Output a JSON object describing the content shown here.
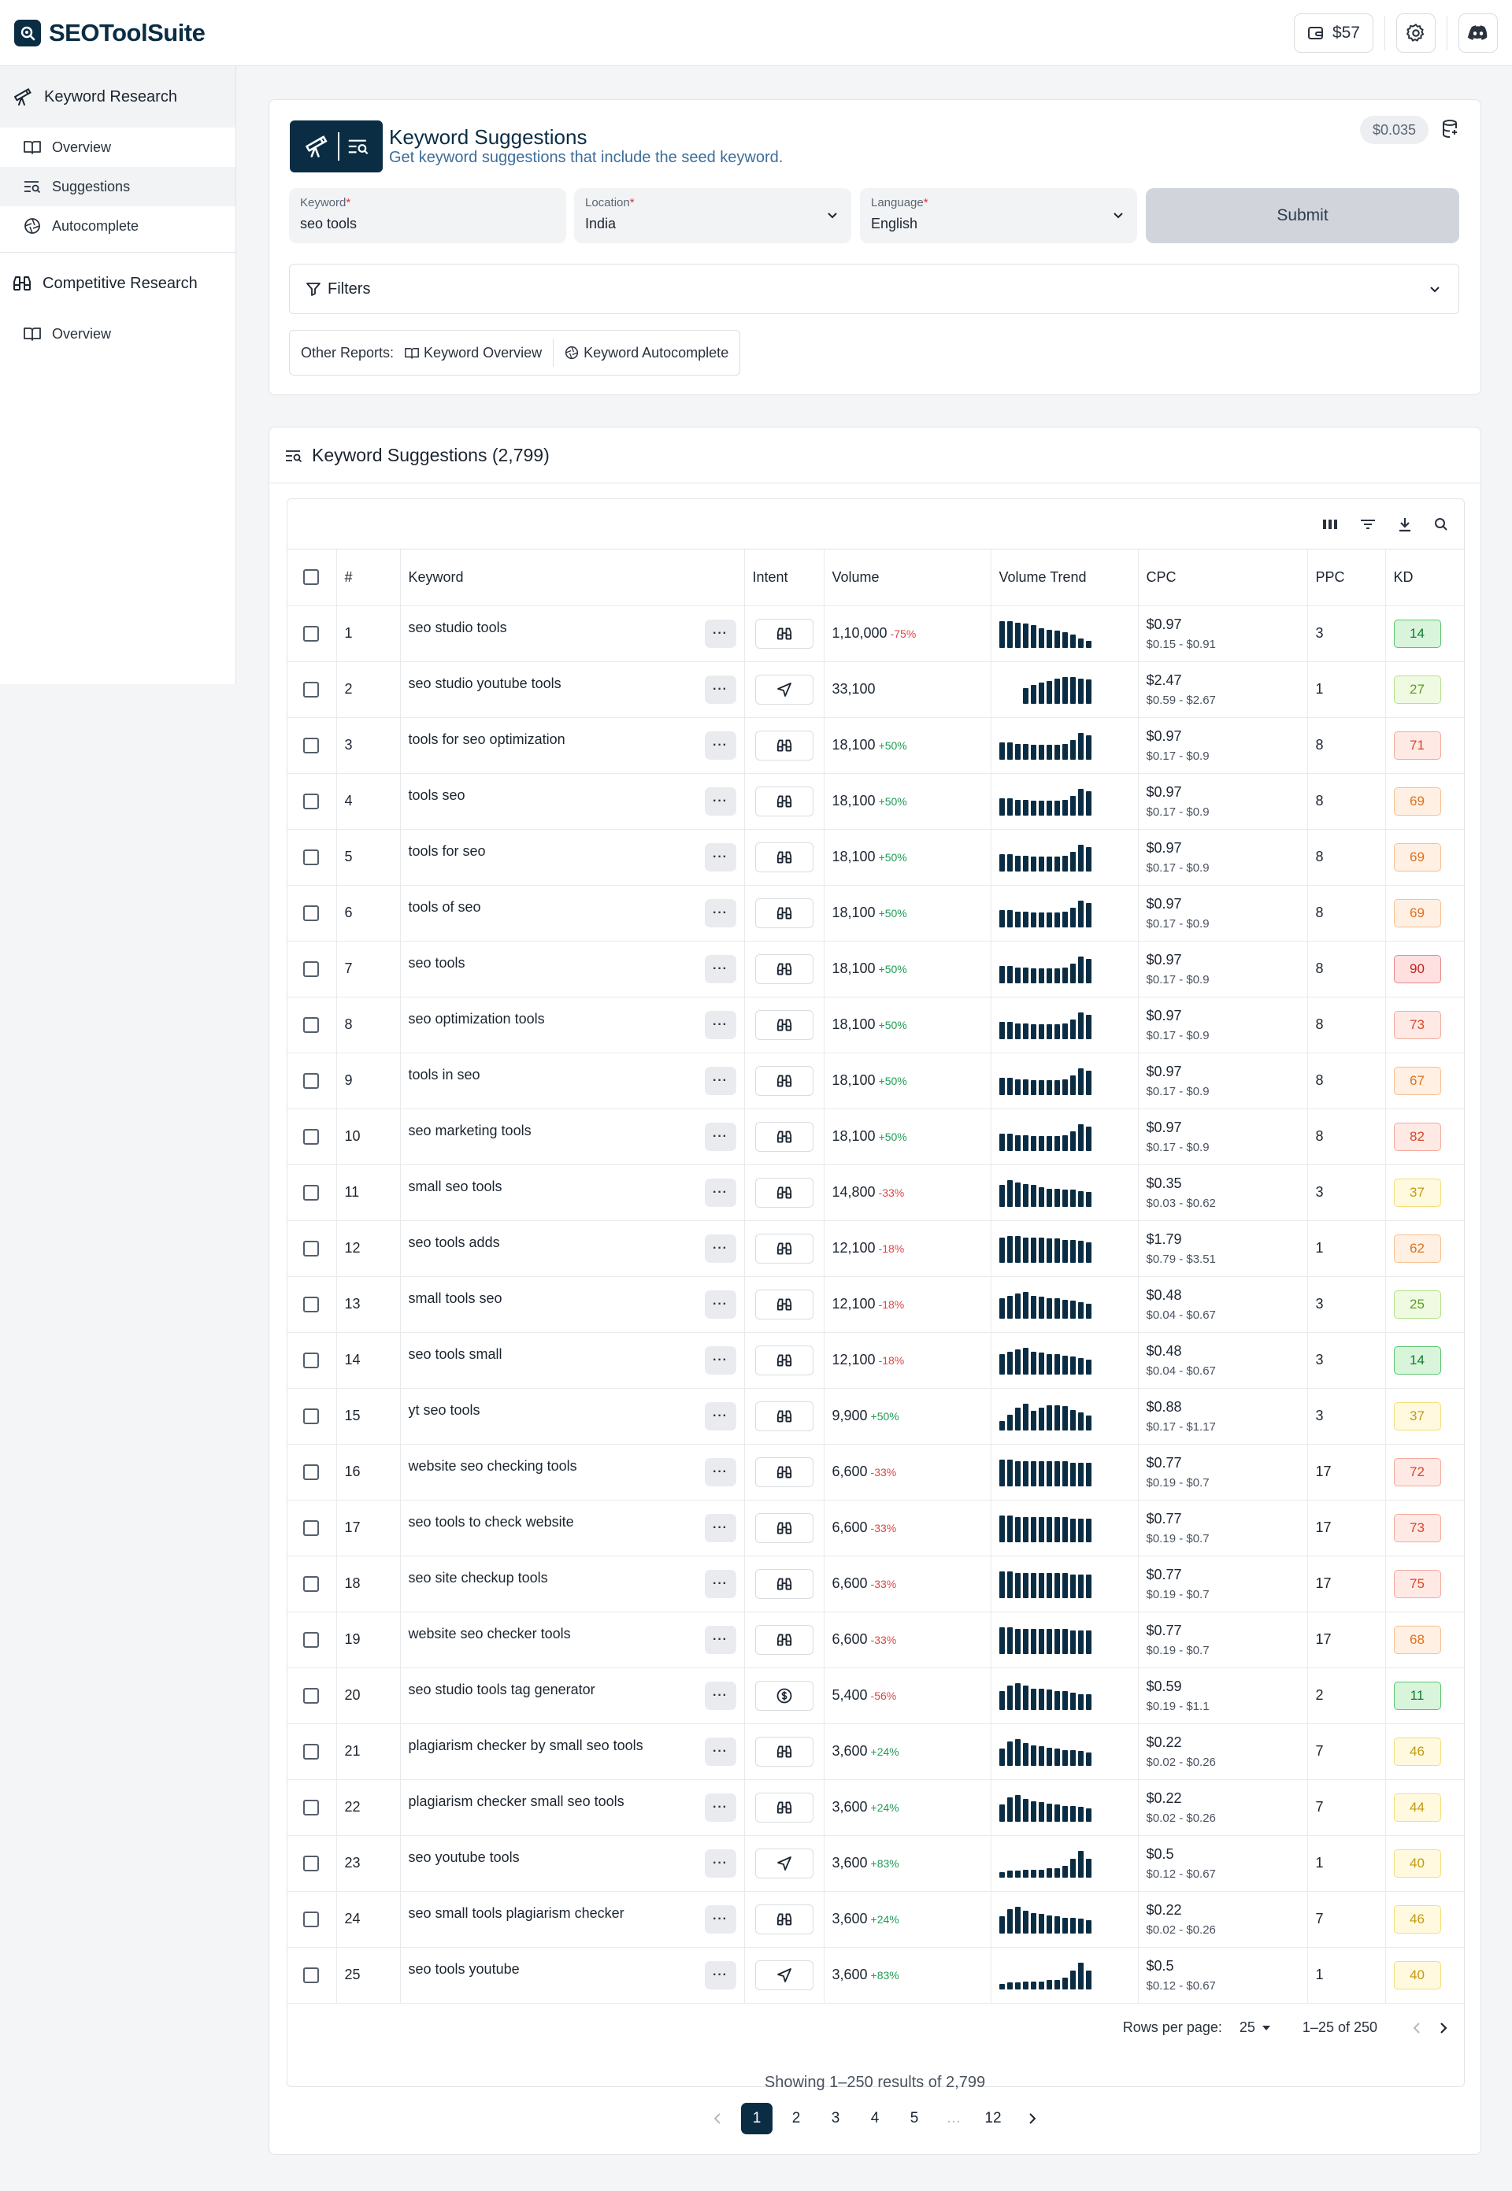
{
  "app": {
    "name": "SEOToolSuite",
    "credits": "$57"
  },
  "sidebar": {
    "groups": [
      {
        "label": "Keyword Research",
        "items": [
          {
            "label": "Overview"
          },
          {
            "label": "Suggestions"
          },
          {
            "label": "Autocomplete"
          }
        ]
      },
      {
        "label": "Competitive Research",
        "items": [
          {
            "label": "Overview"
          }
        ]
      }
    ]
  },
  "form": {
    "title": "Keyword Suggestions",
    "subtitle": "Get keyword suggestions that include the seed keyword.",
    "price": "$0.035",
    "keyword": {
      "label": "Keyword",
      "value": "seo tools"
    },
    "location": {
      "label": "Location",
      "value": "India"
    },
    "language": {
      "label": "Language",
      "value": "English"
    },
    "submit_label": "Submit",
    "filters_label": "Filters",
    "other_reports_label": "Other Reports:",
    "other_reports": [
      "Keyword Overview",
      "Keyword Autocomplete"
    ]
  },
  "results": {
    "title": "Keyword Suggestions (2,799)",
    "columns": {
      "num": "#",
      "keyword": "Keyword",
      "intent": "Intent",
      "volume": "Volume",
      "trend": "Volume Trend",
      "cpc": "CPC",
      "ppc": "PPC",
      "kd": "KD"
    },
    "rows": [
      {
        "n": "1",
        "kw": "seo studio tools",
        "intent": "binoculars",
        "vol": "1,10,000",
        "chg": "-75%",
        "dir": "down",
        "cpc": "$0.97",
        "range": "$0.15 - $0.91",
        "ppc": "3",
        "kd": "14",
        "trend": [
          22,
          22,
          21,
          20,
          19,
          16,
          15,
          14,
          13,
          11,
          8,
          6
        ]
      },
      {
        "n": "2",
        "kw": "seo studio youtube tools",
        "intent": "navigation",
        "vol": "33,100",
        "chg": "",
        "dir": "",
        "cpc": "$2.47",
        "range": "$0.59 - $2.67",
        "ppc": "1",
        "kd": "27",
        "trend": [
          0,
          0,
          0,
          12,
          14,
          16,
          17,
          19,
          20,
          20,
          19,
          18
        ]
      },
      {
        "n": "3",
        "kw": "tools for seo optimization",
        "intent": "binoculars",
        "vol": "18,100",
        "chg": "+50%",
        "dir": "up",
        "cpc": "$0.97",
        "range": "$0.17 - $0.9",
        "ppc": "8",
        "kd": "71",
        "trend": [
          14,
          14,
          13,
          13,
          12,
          12,
          12,
          12,
          13,
          16,
          22,
          20
        ]
      },
      {
        "n": "4",
        "kw": "tools seo",
        "intent": "binoculars",
        "vol": "18,100",
        "chg": "+50%",
        "dir": "up",
        "cpc": "$0.97",
        "range": "$0.17 - $0.9",
        "ppc": "8",
        "kd": "69",
        "trend": [
          14,
          14,
          13,
          13,
          12,
          12,
          12,
          12,
          13,
          16,
          22,
          20
        ]
      },
      {
        "n": "5",
        "kw": "tools for seo",
        "intent": "binoculars",
        "vol": "18,100",
        "chg": "+50%",
        "dir": "up",
        "cpc": "$0.97",
        "range": "$0.17 - $0.9",
        "ppc": "8",
        "kd": "69",
        "trend": [
          14,
          14,
          13,
          13,
          12,
          12,
          12,
          12,
          13,
          16,
          22,
          20
        ]
      },
      {
        "n": "6",
        "kw": "tools of seo",
        "intent": "binoculars",
        "vol": "18,100",
        "chg": "+50%",
        "dir": "up",
        "cpc": "$0.97",
        "range": "$0.17 - $0.9",
        "ppc": "8",
        "kd": "69",
        "trend": [
          14,
          14,
          13,
          13,
          12,
          12,
          12,
          12,
          13,
          16,
          22,
          20
        ]
      },
      {
        "n": "7",
        "kw": "seo tools",
        "intent": "binoculars",
        "vol": "18,100",
        "chg": "+50%",
        "dir": "up",
        "cpc": "$0.97",
        "range": "$0.17 - $0.9",
        "ppc": "8",
        "kd": "90",
        "trend": [
          14,
          14,
          13,
          13,
          12,
          12,
          12,
          12,
          13,
          16,
          22,
          20
        ]
      },
      {
        "n": "8",
        "kw": "seo optimization tools",
        "intent": "binoculars",
        "vol": "18,100",
        "chg": "+50%",
        "dir": "up",
        "cpc": "$0.97",
        "range": "$0.17 - $0.9",
        "ppc": "8",
        "kd": "73",
        "trend": [
          14,
          14,
          13,
          13,
          12,
          12,
          12,
          12,
          13,
          16,
          22,
          20
        ]
      },
      {
        "n": "9",
        "kw": "tools in seo",
        "intent": "binoculars",
        "vol": "18,100",
        "chg": "+50%",
        "dir": "up",
        "cpc": "$0.97",
        "range": "$0.17 - $0.9",
        "ppc": "8",
        "kd": "67",
        "trend": [
          14,
          14,
          13,
          13,
          12,
          12,
          12,
          12,
          13,
          16,
          22,
          20
        ]
      },
      {
        "n": "10",
        "kw": "seo marketing tools",
        "intent": "binoculars",
        "vol": "18,100",
        "chg": "+50%",
        "dir": "up",
        "cpc": "$0.97",
        "range": "$0.17 - $0.9",
        "ppc": "8",
        "kd": "82",
        "trend": [
          14,
          14,
          13,
          13,
          12,
          12,
          12,
          12,
          13,
          16,
          22,
          20
        ]
      },
      {
        "n": "11",
        "kw": "small seo tools",
        "intent": "binoculars",
        "vol": "14,800",
        "chg": "-33%",
        "dir": "down",
        "cpc": "$0.35",
        "range": "$0.03 - $0.62",
        "ppc": "3",
        "kd": "37",
        "trend": [
          18,
          22,
          20,
          19,
          18,
          16,
          15,
          15,
          14,
          14,
          13,
          12
        ]
      },
      {
        "n": "12",
        "kw": "seo tools adds",
        "intent": "binoculars",
        "vol": "12,100",
        "chg": "-18%",
        "dir": "down",
        "cpc": "$1.79",
        "range": "$0.79 - $3.51",
        "ppc": "1",
        "kd": "62",
        "trend": [
          20,
          21,
          21,
          20,
          20,
          20,
          19,
          19,
          18,
          18,
          17,
          16
        ]
      },
      {
        "n": "13",
        "kw": "small tools seo",
        "intent": "binoculars",
        "vol": "12,100",
        "chg": "-18%",
        "dir": "down",
        "cpc": "$0.48",
        "range": "$0.04 - $0.67",
        "ppc": "3",
        "kd": "25",
        "trend": [
          16,
          18,
          20,
          21,
          18,
          17,
          16,
          16,
          15,
          14,
          13,
          12
        ]
      },
      {
        "n": "14",
        "kw": "seo tools small",
        "intent": "binoculars",
        "vol": "12,100",
        "chg": "-18%",
        "dir": "down",
        "cpc": "$0.48",
        "range": "$0.04 - $0.67",
        "ppc": "3",
        "kd": "14",
        "trend": [
          16,
          18,
          20,
          21,
          18,
          17,
          16,
          16,
          15,
          14,
          13,
          12
        ]
      },
      {
        "n": "15",
        "kw": "yt seo tools",
        "intent": "binoculars",
        "vol": "9,900",
        "chg": "+50%",
        "dir": "up",
        "cpc": "$0.88",
        "range": "$0.17 - $1.17",
        "ppc": "3",
        "kd": "37",
        "trend": [
          8,
          13,
          19,
          22,
          16,
          19,
          21,
          21,
          20,
          17,
          15,
          12
        ]
      },
      {
        "n": "16",
        "kw": "website seo checking tools",
        "intent": "binoculars",
        "vol": "6,600",
        "chg": "-33%",
        "dir": "down",
        "cpc": "$0.77",
        "range": "$0.19 - $0.7",
        "ppc": "17",
        "kd": "72",
        "trend": [
          18,
          18,
          17,
          17,
          17,
          17,
          17,
          17,
          17,
          16,
          16,
          16
        ]
      },
      {
        "n": "17",
        "kw": "seo tools to check website",
        "intent": "binoculars",
        "vol": "6,600",
        "chg": "-33%",
        "dir": "down",
        "cpc": "$0.77",
        "range": "$0.19 - $0.7",
        "ppc": "17",
        "kd": "73",
        "trend": [
          18,
          18,
          17,
          17,
          17,
          17,
          17,
          17,
          17,
          16,
          16,
          16
        ]
      },
      {
        "n": "18",
        "kw": "seo site checkup tools",
        "intent": "binoculars",
        "vol": "6,600",
        "chg": "-33%",
        "dir": "down",
        "cpc": "$0.77",
        "range": "$0.19 - $0.7",
        "ppc": "17",
        "kd": "75",
        "trend": [
          18,
          18,
          17,
          17,
          17,
          17,
          17,
          17,
          17,
          16,
          16,
          16
        ]
      },
      {
        "n": "19",
        "kw": "website seo checker tools",
        "intent": "binoculars",
        "vol": "6,600",
        "chg": "-33%",
        "dir": "down",
        "cpc": "$0.77",
        "range": "$0.19 - $0.7",
        "ppc": "17",
        "kd": "68",
        "trend": [
          18,
          18,
          17,
          17,
          17,
          17,
          17,
          17,
          17,
          16,
          16,
          16
        ]
      },
      {
        "n": "20",
        "kw": "seo studio tools tag generator",
        "intent": "dollar",
        "vol": "5,400",
        "chg": "-56%",
        "dir": "down",
        "cpc": "$0.59",
        "range": "$0.19 - $1.1",
        "ppc": "2",
        "kd": "11",
        "trend": [
          14,
          18,
          20,
          18,
          16,
          16,
          15,
          14,
          14,
          13,
          12,
          12
        ]
      },
      {
        "n": "21",
        "kw": "plagiarism checker by small seo tools",
        "intent": "binoculars",
        "vol": "3,600",
        "chg": "+24%",
        "dir": "up",
        "cpc": "$0.22",
        "range": "$0.02 - $0.26",
        "ppc": "7",
        "kd": "46",
        "trend": [
          14,
          20,
          22,
          19,
          17,
          16,
          15,
          14,
          13,
          13,
          12,
          11
        ]
      },
      {
        "n": "22",
        "kw": "plagiarism checker small seo tools",
        "intent": "binoculars",
        "vol": "3,600",
        "chg": "+24%",
        "dir": "up",
        "cpc": "$0.22",
        "range": "$0.02 - $0.26",
        "ppc": "7",
        "kd": "44",
        "trend": [
          14,
          20,
          22,
          19,
          17,
          16,
          15,
          14,
          13,
          13,
          12,
          11
        ]
      },
      {
        "n": "23",
        "kw": "seo youtube tools",
        "intent": "navigation",
        "vol": "3,600",
        "chg": "+83%",
        "dir": "up",
        "cpc": "$0.5",
        "range": "$0.12 - $0.67",
        "ppc": "1",
        "kd": "40",
        "trend": [
          4,
          5,
          5,
          6,
          6,
          6,
          7,
          7,
          9,
          14,
          20,
          14
        ]
      },
      {
        "n": "24",
        "kw": "seo small tools plagiarism checker",
        "intent": "binoculars",
        "vol": "3,600",
        "chg": "+24%",
        "dir": "up",
        "cpc": "$0.22",
        "range": "$0.02 - $0.26",
        "ppc": "7",
        "kd": "46",
        "trend": [
          14,
          20,
          22,
          19,
          17,
          16,
          15,
          14,
          13,
          13,
          12,
          11
        ]
      },
      {
        "n": "25",
        "kw": "seo tools youtube",
        "intent": "navigation",
        "vol": "3,600",
        "chg": "+83%",
        "dir": "up",
        "cpc": "$0.5",
        "range": "$0.12 - $0.67",
        "ppc": "1",
        "kd": "40",
        "trend": [
          4,
          5,
          5,
          6,
          6,
          6,
          7,
          7,
          9,
          14,
          20,
          14
        ]
      }
    ],
    "footer": {
      "rows_per_page_label": "Rows per page:",
      "rows_per_page": "25",
      "range": "1–25 of 250"
    },
    "showing": "Showing 1–250 results of 2,799",
    "pages": [
      "1",
      "2",
      "3",
      "4",
      "5",
      "…",
      "12"
    ]
  },
  "colors": {
    "brand": "#0b2d44",
    "up": "#1f9d55",
    "down": "#e04444"
  }
}
